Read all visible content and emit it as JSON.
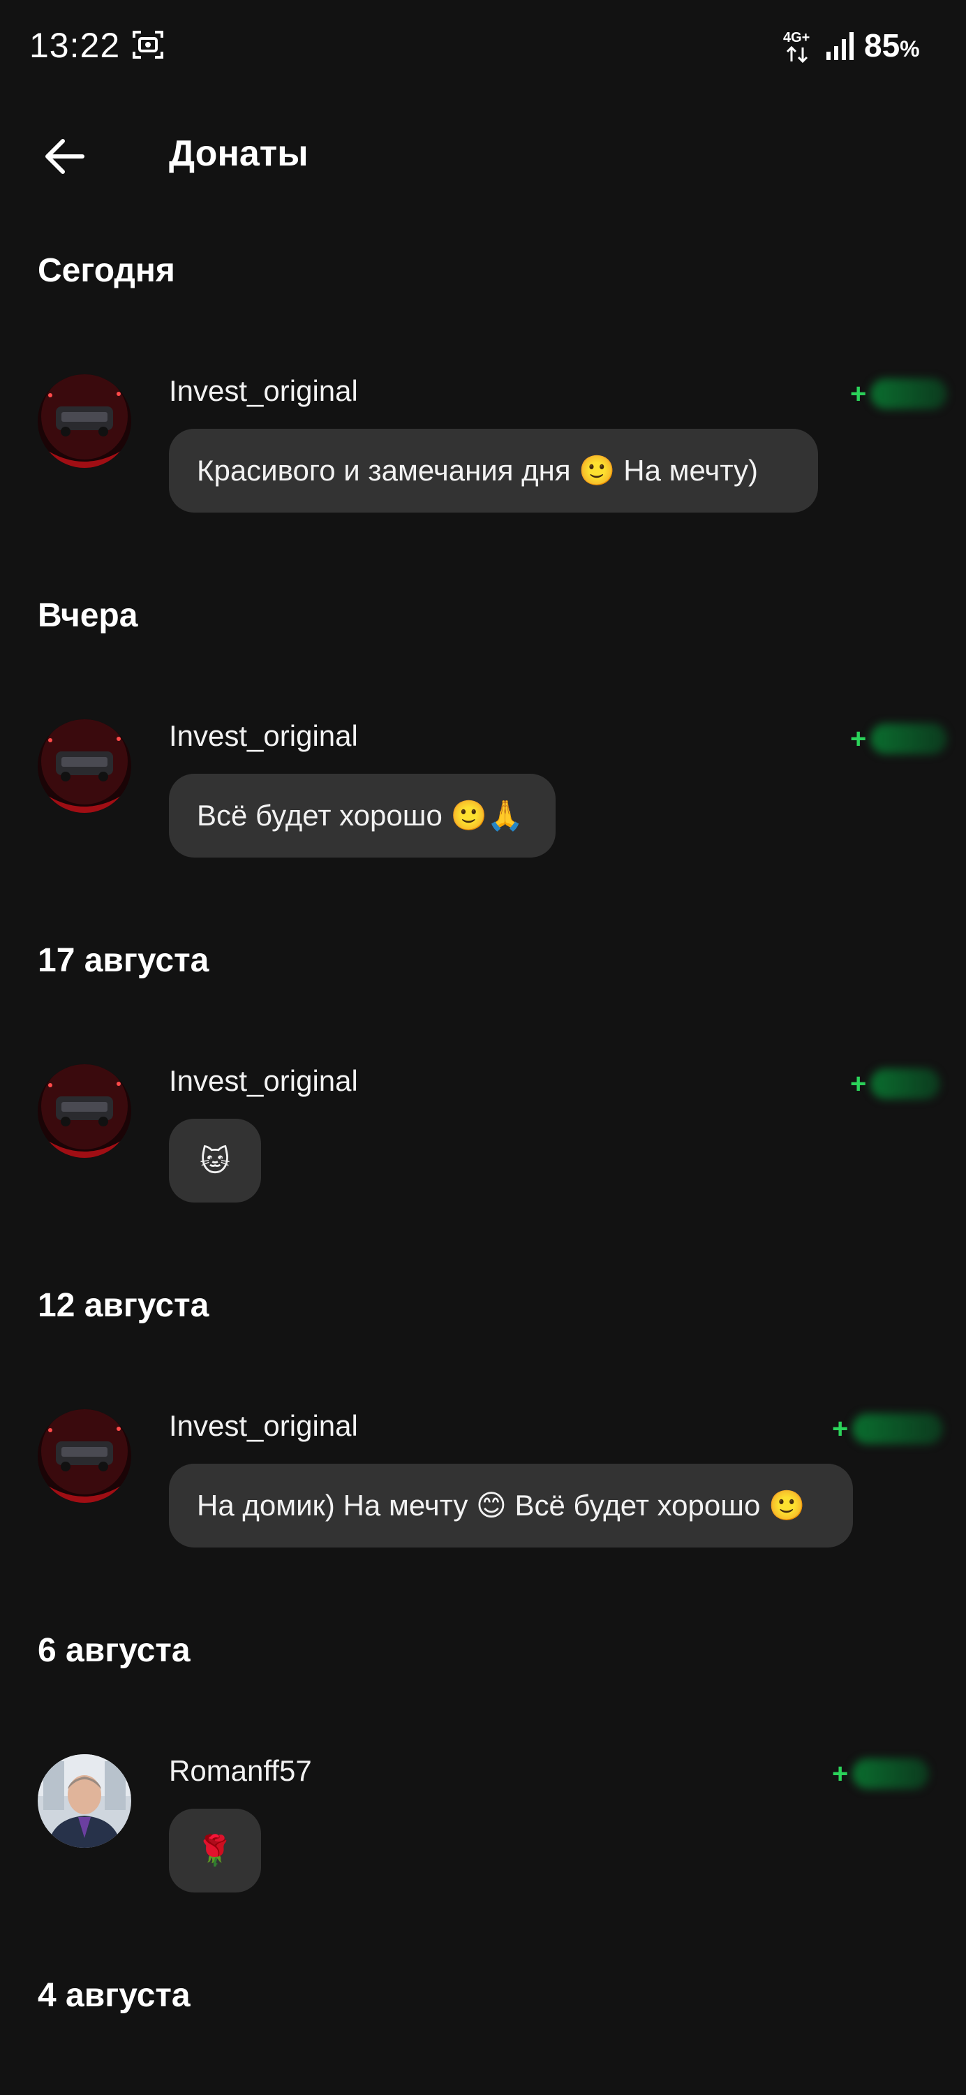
{
  "status_bar": {
    "time": "13:22",
    "network": "4G+",
    "battery": "85",
    "battery_unit": "%"
  },
  "header": {
    "title": "Донаты",
    "back_icon": "arrow-left-icon"
  },
  "accent_color": "#2bd35a",
  "sections": [
    {
      "date": "Сегодня",
      "donations": [
        {
          "sender": "Invest_original",
          "amount_prefix": "+",
          "message": "Красивого и замечания дня 🙂  На мечту)"
        }
      ]
    },
    {
      "date": "Вчера",
      "donations": [
        {
          "sender": "Invest_original",
          "amount_prefix": "+",
          "message": "Всё будет хорошо 🙂🙏"
        }
      ]
    },
    {
      "date": "17 августа",
      "donations": [
        {
          "sender": "Invest_original",
          "amount_prefix": "+",
          "message": "🐱"
        }
      ]
    },
    {
      "date": "12 августа",
      "donations": [
        {
          "sender": "Invest_original",
          "amount_prefix": "+",
          "message": "На домик) На мечту 😊 Всё будет хорошо 🙂"
        }
      ]
    },
    {
      "date": "6 августа",
      "donations": [
        {
          "sender": "Romanff57",
          "amount_prefix": "+",
          "message": "🌹"
        }
      ]
    },
    {
      "date": "4 августа",
      "donations": []
    }
  ]
}
